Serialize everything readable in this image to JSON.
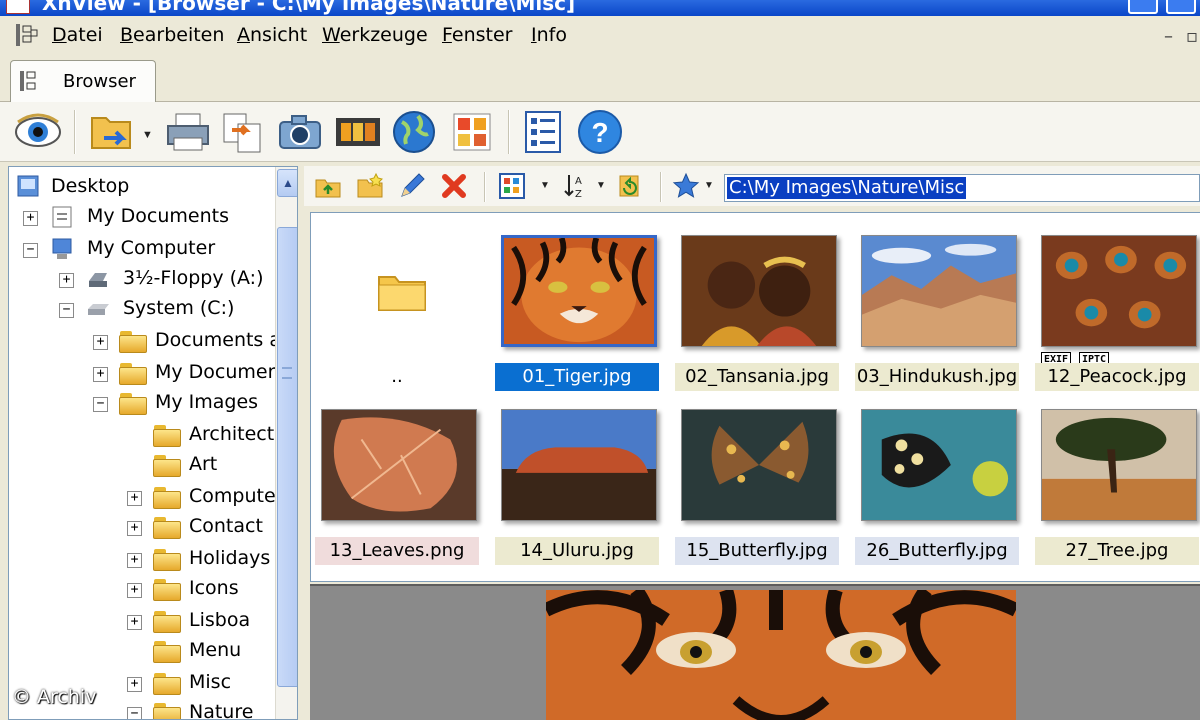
{
  "window": {
    "title": "XnView - [Browser - C:\\My Images\\Nature\\Misc]"
  },
  "menu": {
    "items": [
      "Datei",
      "Bearbeiten",
      "Ansicht",
      "Werkzeuge",
      "Fenster",
      "Info"
    ],
    "first_letters": [
      "D",
      "B",
      "A",
      "W",
      "F",
      "I"
    ],
    "rest": [
      "atei",
      "earbeiten",
      "nsicht",
      "erkzeuge",
      "enster",
      "nfo"
    ],
    "mdi_minimize": "–",
    "mdi_restore": "▫"
  },
  "tabs": [
    {
      "label": "Browser",
      "active": true
    }
  ],
  "toolbar": {
    "buttons": [
      "view-icon",
      "open-folder-icon",
      "print-icon",
      "convert-icon",
      "camera-icon",
      "slideshow-icon",
      "web-icon",
      "contact-sheet-icon",
      "batch-icon",
      "help-icon"
    ]
  },
  "tree": {
    "items": [
      {
        "label": "Desktop",
        "icon": "desktop-icon",
        "expander": ""
      },
      {
        "label": "My Documents",
        "icon": "documents-icon",
        "expander": "+"
      },
      {
        "label": "My Computer",
        "icon": "computer-icon",
        "expander": "−"
      },
      {
        "label": "3½-Floppy (A:)",
        "icon": "floppy-icon",
        "expander": "+"
      },
      {
        "label": "System (C:)",
        "icon": "drive-icon",
        "expander": "−"
      },
      {
        "label": "Documents a",
        "icon": "folder-icon",
        "expander": "+"
      },
      {
        "label": "My Documen",
        "icon": "folder-icon",
        "expander": "+"
      },
      {
        "label": "My Images",
        "icon": "folder-icon",
        "expander": "−"
      },
      {
        "label": "Architect",
        "icon": "folder-icon",
        "expander": ""
      },
      {
        "label": "Art",
        "icon": "folder-icon",
        "expander": ""
      },
      {
        "label": "Compute",
        "icon": "folder-icon",
        "expander": "+"
      },
      {
        "label": "Contact",
        "icon": "folder-icon",
        "expander": "+"
      },
      {
        "label": "Holidays",
        "icon": "folder-icon",
        "expander": "+"
      },
      {
        "label": "Icons",
        "icon": "folder-icon",
        "expander": "+"
      },
      {
        "label": "Lisboa",
        "icon": "folder-icon",
        "expander": "+"
      },
      {
        "label": "Menu",
        "icon": "folder-icon",
        "expander": ""
      },
      {
        "label": "Misc",
        "icon": "folder-icon",
        "expander": "+"
      },
      {
        "label": "Nature",
        "icon": "folder-icon",
        "expander": "−"
      }
    ]
  },
  "address": {
    "path": "C:\\My Images\\Nature\\Misc"
  },
  "thumbnails": [
    {
      "name": "..",
      "kind": "parent-folder"
    },
    {
      "name": "01_Tiger.jpg",
      "selected": true
    },
    {
      "name": "02_Tansania.jpg"
    },
    {
      "name": "03_Hindukush.jpg"
    },
    {
      "name": "12_Peacock.jpg",
      "badges": [
        "EXIF",
        "IPTC"
      ]
    },
    {
      "name": "13_Leaves.png"
    },
    {
      "name": "14_Uluru.jpg"
    },
    {
      "name": "15_Butterfly.jpg"
    },
    {
      "name": "26_Butterfly.jpg"
    },
    {
      "name": "27_Tree.jpg"
    }
  ],
  "badges": {
    "exif": "EXIF",
    "iptc": "IPTC"
  },
  "credit": "© Archiv",
  "colors": {
    "selection": "#0a6fd1",
    "title_bar": "#0a46c8",
    "caption_jpg": "#ecead0",
    "caption_png": "#f0dcdc",
    "caption_butterfly": "#dde3f0"
  }
}
